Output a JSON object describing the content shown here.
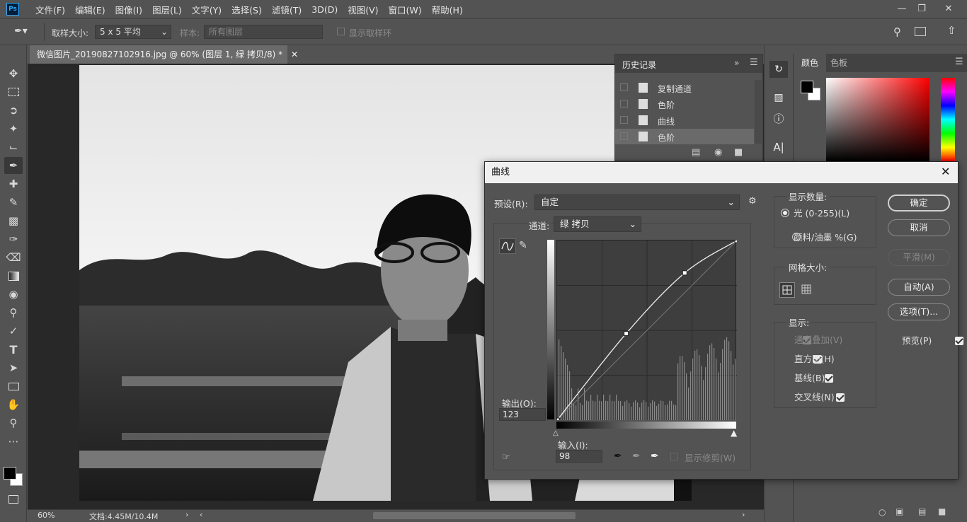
{
  "app": {
    "logo": "Ps"
  },
  "menu": [
    "文件(F)",
    "编辑(E)",
    "图像(I)",
    "图层(L)",
    "文字(Y)",
    "选择(S)",
    "滤镜(T)",
    "3D(D)",
    "视图(V)",
    "窗口(W)",
    "帮助(H)"
  ],
  "options": {
    "sample_size_label": "取样大小:",
    "sample_size_value": "5 x 5 平均",
    "sample_label": "样本:",
    "sample_value": "所有图层",
    "show_ring_label": "显示取样环"
  },
  "document": {
    "tab_title": "微信图片_20190827102916.jpg @ 60% (图层 1, 绿 拷贝/8) *",
    "zoom": "60%",
    "doc_size": "文档:4.45M/10.4M"
  },
  "history": {
    "title": "历史记录",
    "items": [
      "复制通道",
      "色阶",
      "曲线",
      "色阶"
    ]
  },
  "color_panel": {
    "tabs": [
      "颜色",
      "色板"
    ]
  },
  "curves": {
    "title": "曲线",
    "preset_label": "预设(R):",
    "preset_value": "自定",
    "channel_label": "通道:",
    "channel_value": "绿 拷贝",
    "output_label": "输出(O):",
    "output_value": "123",
    "input_label": "输入(I):",
    "input_value": "98",
    "show_clipping_label": "显示修剪(W)",
    "show_amount_title": "显示数量:",
    "light_label": "光 (0-255)(L)",
    "pigment_label": "颜料/油墨 %(G)",
    "grid_size_title": "网格大小:",
    "display_title": "显示:",
    "channel_overlays": "通道叠加(V)",
    "histogram": "直方图(H)",
    "baseline": "基线(B)",
    "intersection": "交叉线(N)",
    "ok": "确定",
    "cancel": "取消",
    "smooth": "平滑(M)",
    "auto": "自动(A)",
    "options": "选项(T)...",
    "preview": "预览(P)",
    "curve_points": [
      [
        0,
        0
      ],
      [
        98,
        123
      ],
      [
        181,
        209
      ],
      [
        255,
        255
      ]
    ]
  }
}
